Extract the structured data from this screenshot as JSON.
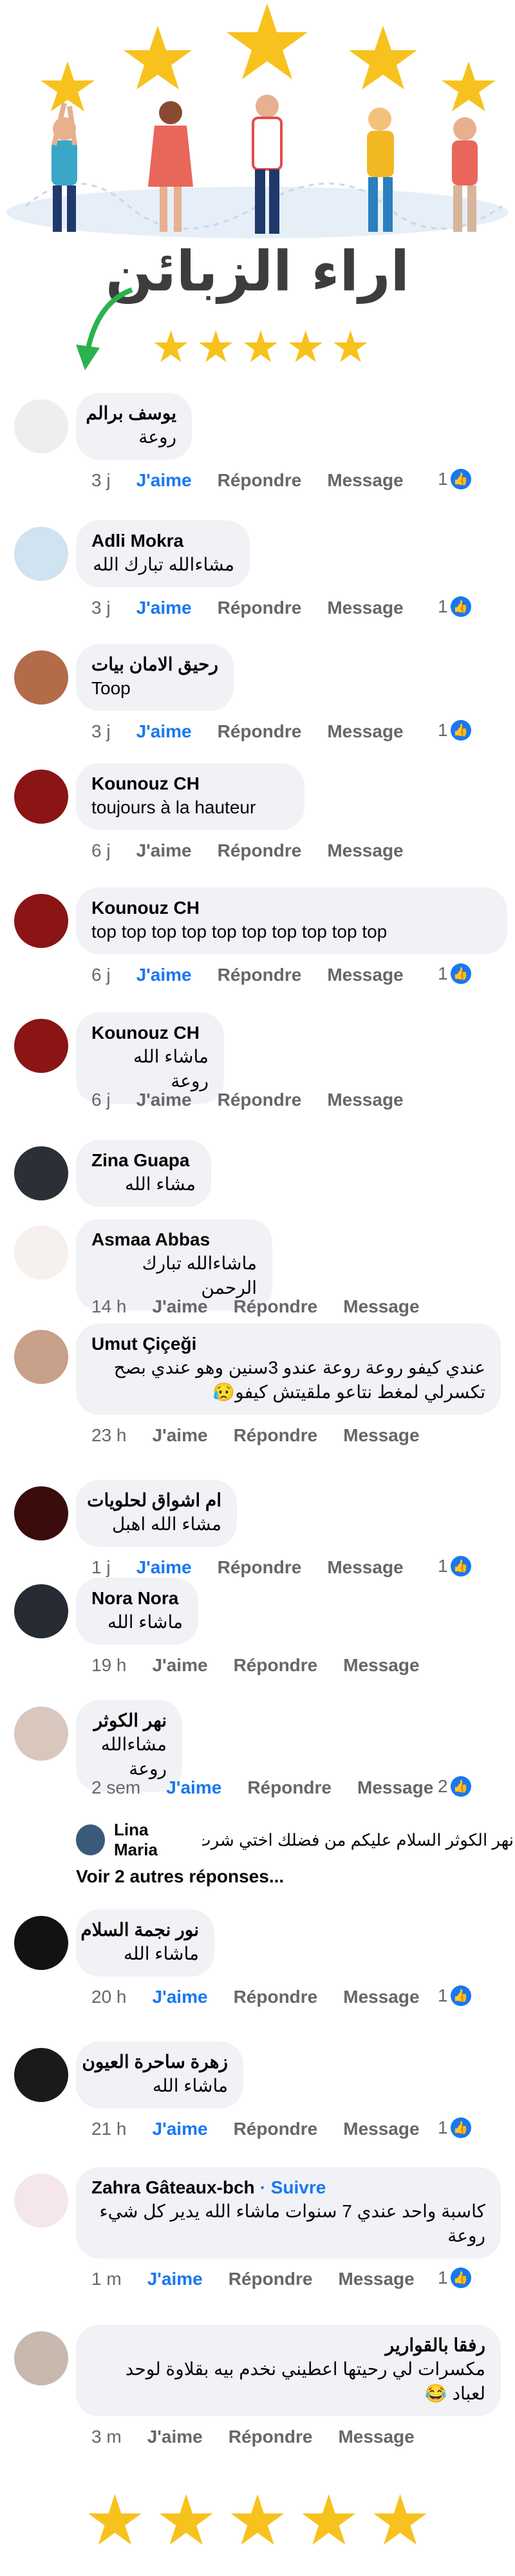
{
  "hero": {
    "title": "اراء الزبائن",
    "stars": [
      "★",
      "★",
      "★",
      "★",
      "★"
    ]
  },
  "like_label": "J'aime",
  "reply_label": "Répondre",
  "message_label": "Message",
  "like_icon": "thumbs-up-icon",
  "comments": [
    {
      "name": "يوسف برالم",
      "text": "روعة",
      "time": "3 j",
      "liked": true,
      "reactions": "1",
      "avatar_color": "#eeeeee"
    },
    {
      "name": "Adli Mokra",
      "text": "مشاءالله تبارك الله",
      "time": "3 j",
      "liked": true,
      "reactions": "1",
      "avatar_color": "#cfe3f0"
    },
    {
      "name": "رحيق الامان بيات",
      "text": "Toop",
      "time": "3 j",
      "liked": true,
      "reactions": "1",
      "avatar_color": "#b36b4a"
    },
    {
      "name": "Kounouz CH",
      "text": "toujours à la hauteur",
      "time": "6 j",
      "liked": false,
      "reactions": "",
      "avatar_color": "#8b1414"
    },
    {
      "name": "Kounouz CH",
      "text": "top top top top top top top top top top",
      "time": "6 j",
      "liked": true,
      "reactions": "1",
      "avatar_color": "#8b1414"
    },
    {
      "name": "Kounouz CH",
      "text": "ماشاء الله روعة",
      "time": "6 j",
      "liked": false,
      "reactions": "",
      "avatar_color": "#8b1414"
    },
    {
      "name": "Zina Guapa",
      "text": "مشاء الله",
      "time": "",
      "liked": false,
      "reactions": "",
      "avatar_color": "#2b2f36"
    },
    {
      "name": "Asmaa Abbas",
      "text": "ماشاءالله تبارك الرحمن",
      "time": "14 h",
      "liked": false,
      "reactions": "",
      "avatar_color": "#f6f0ee"
    },
    {
      "name": "Umut Çiçeği",
      "text": "عندي كيفو روعة روعة عندو 3سنين وهو عندي بصح تكسرلي لمغط نتاعو ملقيتش كيفو😥",
      "time": "23 h",
      "liked": false,
      "reactions": "",
      "avatar_color": "#c9a08a"
    },
    {
      "name": "ام اشواق لحلويات",
      "text": "مشاء الله اهبل",
      "time": "1 j",
      "liked": true,
      "reactions": "1",
      "avatar_color": "#3a0c0c"
    },
    {
      "name": "Nora Nora",
      "text": "ماشاء الله",
      "time": "19 h",
      "liked": false,
      "reactions": "",
      "avatar_color": "#262a33"
    },
    {
      "name": "نهر الكوثر",
      "text": "مشاءالله روعة",
      "time": "2 sem",
      "liked": true,
      "reactions": "2",
      "avatar_color": "#d9c7bd"
    },
    {
      "name": "نور نجمة السلام",
      "text": "ماشاء الله",
      "time": "20 h",
      "liked": true,
      "reactions": "1",
      "avatar_color": "#121212"
    },
    {
      "name": "زهرة ساحرة العيون",
      "text": "ماشاء الله",
      "time": "21 h",
      "liked": true,
      "reactions": "1",
      "avatar_color": "#1a1a1a"
    },
    {
      "name": "Zahra Gâteaux-bch",
      "follow": "· Suivre",
      "text": "كاسبة واحد عندي 7 سنوات ماشاء الله يدير كل شيء روعة",
      "time": "1 m",
      "liked": true,
      "reactions": "1",
      "avatar_color": "#f4e6ea"
    },
    {
      "name": "رفقا بالقوارير",
      "text": "مكسرات لي رحيتها اعطيني نخدم بيه بقلاوة لوحد لعباد 😂",
      "time": "3 m",
      "liked": false,
      "reactions": "",
      "avatar_color": "#c8b8ae"
    }
  ],
  "reply_preview": {
    "name": "Lina Maria",
    "text": "نهر الكوثر السلام عليكم من فضلك اختي شرت...",
    "more": "Voir 2 autres réponses..."
  },
  "footer_stars": [
    "★",
    "★",
    "★",
    "★",
    "★"
  ]
}
